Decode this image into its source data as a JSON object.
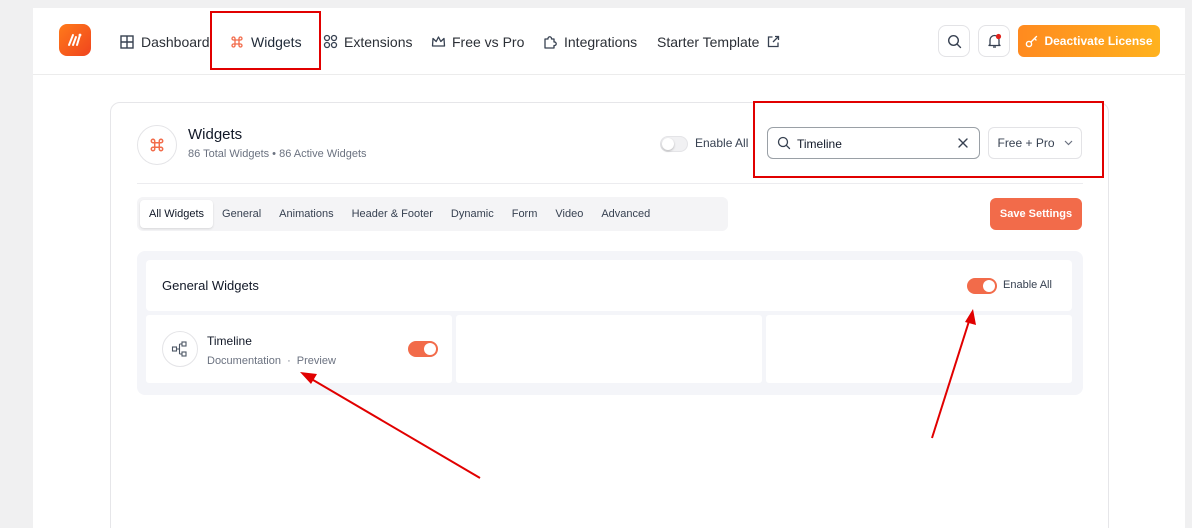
{
  "nav": {
    "items": [
      {
        "label": "Dashboard",
        "icon": "grid-icon"
      },
      {
        "label": "Widgets",
        "icon": "command-icon"
      },
      {
        "label": "Extensions",
        "icon": "nodes-icon"
      },
      {
        "label": "Free vs Pro",
        "icon": "crown-icon"
      },
      {
        "label": "Integrations",
        "icon": "puzzle-icon"
      },
      {
        "label": "Starter Template",
        "icon": "external-link-icon"
      }
    ],
    "deactivate_label": "Deactivate License"
  },
  "widgets_header": {
    "title": "Widgets",
    "subtitle": "86 Total Widgets • 86 Active Widgets",
    "enable_all_label": "Enable All"
  },
  "search": {
    "value": "Timeline",
    "filter_label": "Free + Pro"
  },
  "tabs": [
    "All Widgets",
    "General",
    "Animations",
    "Header & Footer",
    "Dynamic",
    "Form",
    "Video",
    "Advanced"
  ],
  "save_label": "Save Settings",
  "general_panel": {
    "title": "General Widgets",
    "enable_all_label": "Enable All",
    "widget": {
      "name": "Timeline",
      "doc_link": "Documentation",
      "separator": "·",
      "preview_link": "Preview"
    }
  },
  "colors": {
    "accent": "#f26b4a",
    "deactivate": "#ff9a1f",
    "annotation": "#e10000"
  }
}
